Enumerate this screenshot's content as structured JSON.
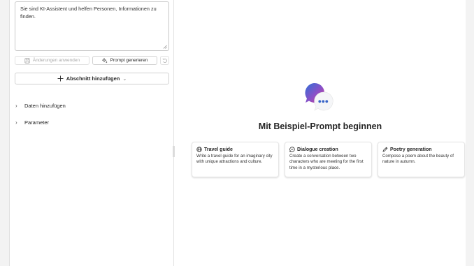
{
  "system_prompt": {
    "value": "Sie sind KI-Assistent und helfen Personen, Informationen zu finden."
  },
  "buttons": {
    "apply_changes": "Änderungen anwenden",
    "generate_prompt": "Prompt generieren",
    "add_section": "Abschnitt hinzufügen",
    "add_section_chevron": "⌄"
  },
  "expanders": [
    {
      "label": "Daten hinzufügen",
      "caret": "›"
    },
    {
      "label": "Parameter",
      "caret": "›"
    }
  ],
  "main": {
    "title": "Mit Beispiel-Prompt beginnen",
    "cards": [
      {
        "title": "Travel guide",
        "icon": "globe-icon",
        "desc": "Write a travel guide for an imaginary city with unique attractions and culture."
      },
      {
        "title": "Dialogue creation",
        "icon": "chat-bubble-icon",
        "desc": "Create a conversation between two characters who are meeting for the first time in a mysterious place."
      },
      {
        "title": "Poetry generation",
        "icon": "pen-icon",
        "desc": "Compose a poem about the beauty of nature in autumn."
      }
    ]
  },
  "colors": {
    "accent_blue": "#2f6fd6",
    "accent_purple": "#8b4fc7",
    "accent_pink": "#d1428f"
  }
}
